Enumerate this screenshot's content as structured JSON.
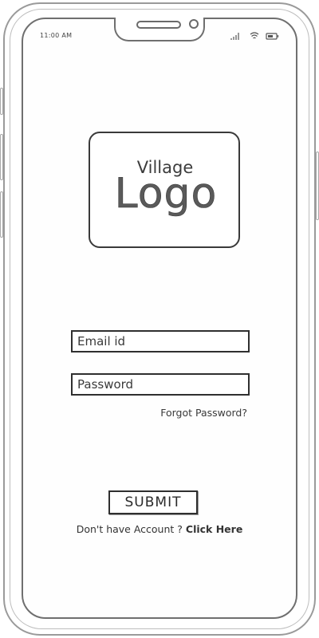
{
  "status_bar": {
    "time": "11:00 AM",
    "icons": [
      "signal-icon",
      "wifi-icon",
      "battery-icon"
    ]
  },
  "logo": {
    "line1": "Village",
    "line2": "Logo"
  },
  "form": {
    "email_placeholder": "Email id",
    "password_placeholder": "Password",
    "forgot_label": "Forgot Password?",
    "submit_label": "SUBMIT"
  },
  "signup": {
    "prompt": "Don't have Account ?",
    "link_label": "Click Here"
  },
  "colors": {
    "stroke": "#2f2f2f",
    "text": "#333333",
    "background": "#ffffff"
  }
}
